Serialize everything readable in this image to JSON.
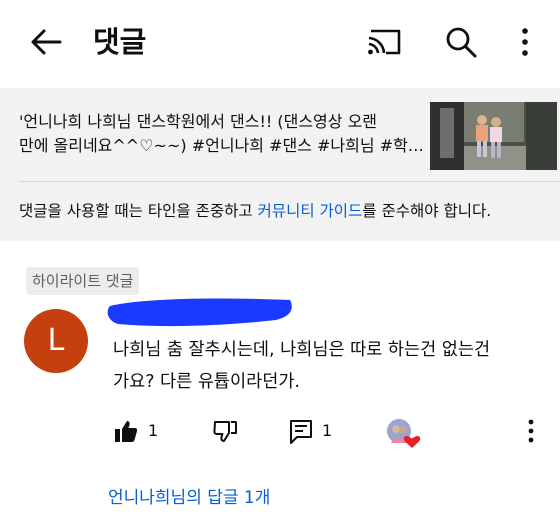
{
  "header": {
    "title": "댓글",
    "icons": [
      "back-arrow-icon",
      "cast-icon",
      "search-icon",
      "more-vert-icon"
    ]
  },
  "video": {
    "description_line1": "'언니나희 나희님 댄스학원에서 댄스!!  (댄스영상 오랜",
    "description_line2": "만에 올리네요^^♡~~)  #언니나희 #댄스 #나희님 #학…"
  },
  "guidelines": {
    "before": "댓글을 사용할 때는 타인을 존중하고 ",
    "link": "커뮤니티 가이드",
    "after": "를 준수해야 합니다."
  },
  "comment": {
    "badge": "하이라이트 댓글",
    "avatar_letter": "L",
    "avatar_color": "#c5400f",
    "text_line1": "나희님 춤 잘추시는데, 나희님은 따로 하는건 없는건",
    "text_line2": "가요? 다른 유튭이라던가.",
    "like_count": "1",
    "reply_count": "1",
    "replies_link": "언니나희님의 답글 1개"
  },
  "colors": {
    "link": "#065fd4",
    "redaction": "#1a3bff",
    "heart": "#e8202a"
  }
}
